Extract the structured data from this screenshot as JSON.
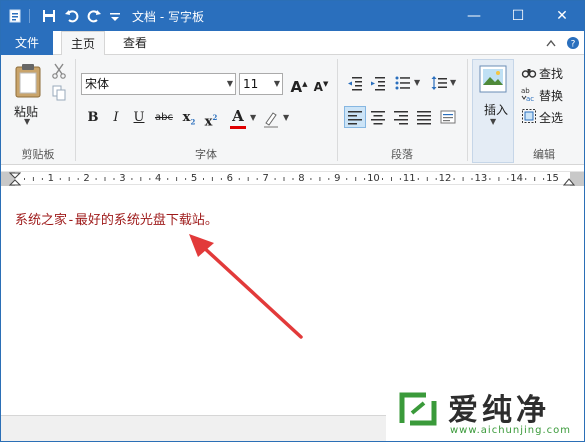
{
  "window": {
    "title": "文档 - 写字板",
    "minimize": "—",
    "maximize": "☐",
    "close": "✕"
  },
  "ribbon_tabs": {
    "file": "文件",
    "home": "主页",
    "view": "查看"
  },
  "clipboard": {
    "paste_label": "粘贴",
    "group_label": "剪贴板"
  },
  "font": {
    "family_value": "宋体",
    "size_value": "11",
    "grow": "A",
    "shrink": "A",
    "bold": "B",
    "italic": "I",
    "underline": "U",
    "strike": "abc",
    "subscript": "x",
    "superscript": "x",
    "sub_mark": "2",
    "sup_mark": "2",
    "text_color_letter": "A",
    "group_label": "字体"
  },
  "paragraph": {
    "group_label": "段落"
  },
  "insert": {
    "label": "插入"
  },
  "editing": {
    "find": "查找",
    "replace": "替换",
    "select_all": "全选",
    "group_label": "编辑"
  },
  "ruler": {
    "marks": [
      "1",
      "2",
      "3",
      "4",
      "5",
      "6",
      "7",
      "8",
      "9",
      "10",
      "11",
      "12",
      "13",
      "14",
      "15"
    ]
  },
  "document": {
    "text": "系统之家-最好的系统光盘下载站。"
  },
  "watermark": {
    "brand": "爱纯净",
    "url": "www.aichunjing.com"
  },
  "colors": {
    "title_blue": "#2a6fbd",
    "doc_text": "#9e1a1a",
    "arrow_red": "#e23a3a",
    "watermark_green": "#3a9a3a"
  }
}
